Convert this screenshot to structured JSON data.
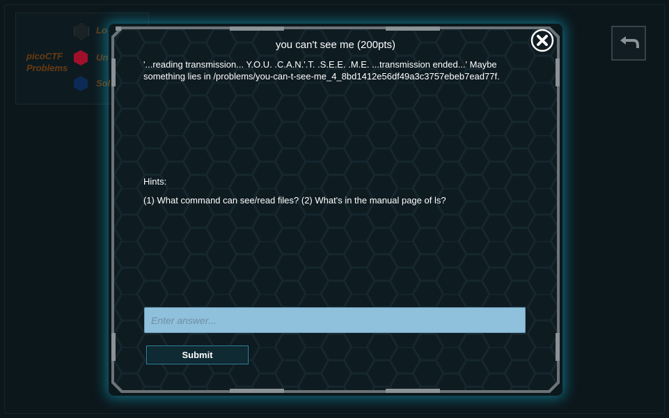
{
  "sidebar": {
    "title": "picoCTF Problems",
    "items": [
      {
        "label": "Lo",
        "icon": "hexagon-icon",
        "color": "#1a2226"
      },
      {
        "label": "Un",
        "icon": "hexagon-icon",
        "color": "#a0102a"
      },
      {
        "label": "Sol",
        "icon": "hexagon-icon",
        "color": "#0c2a55"
      }
    ]
  },
  "back_button": {
    "icon": "back-arrow-icon"
  },
  "modal": {
    "title": "you can't see me (200pts)",
    "description": "'...reading transmission... Y.O.U. .C.A.N.'.T. .S.E.E. .M.E.  ...transmission ended...' Maybe something lies in /problems/you-can-t-see-me_4_8bd1412e56df49a3c3757ebeb7ead77f.",
    "hints_label": "Hints:",
    "hints": "(1) What command can see/read files? (2) What's in the manual page of ls?",
    "answer_placeholder": "Enter answer...",
    "answer_value": "",
    "submit_label": "Submit",
    "close_icon": "close-icon"
  },
  "colors": {
    "frame_glow": "#14aac8",
    "answer_field": "#8fc0dc",
    "submit_border": "#2f8fa8",
    "sidebar_text": "#6b3a10"
  }
}
